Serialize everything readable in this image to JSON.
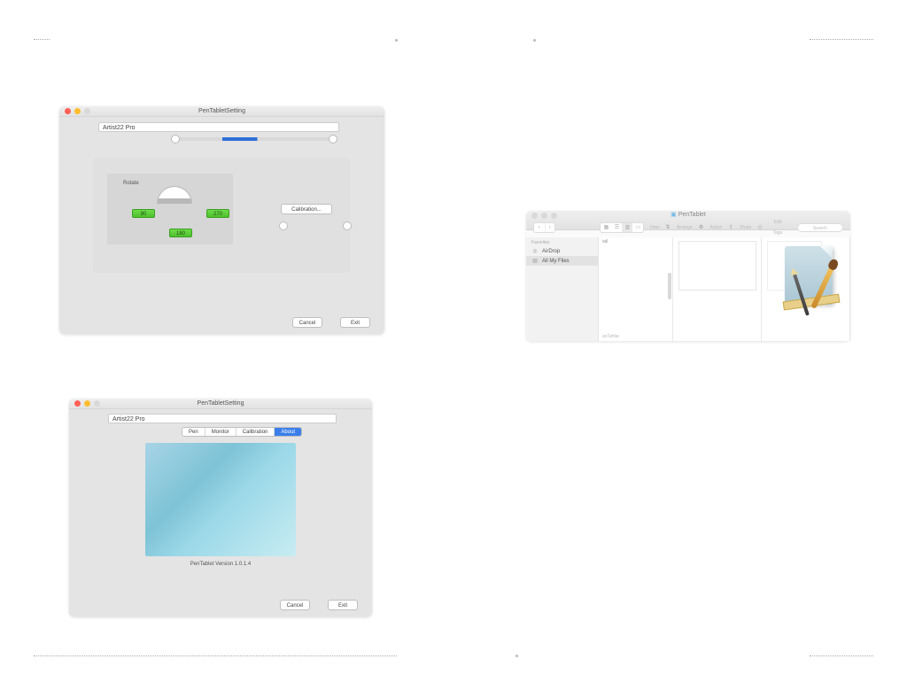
{
  "windowA": {
    "title": "PenTabletSetting",
    "device": "Artist22 Pro",
    "rotate_label": "Rotate",
    "rotate_values": {
      "v90": "90",
      "v180": "180",
      "v270": "270"
    },
    "calibration_btn": "Calibration...",
    "cancel": "Cancel",
    "exit": "Exit"
  },
  "windowB": {
    "title": "PenTabletSetting",
    "device": "Artist22 Pro",
    "tabs": {
      "pen": "Pen",
      "monitor": "Monitor",
      "calibration": "Calibration",
      "about": "About"
    },
    "version": "PenTablet Version  1.0.1.4",
    "cancel": "Cancel",
    "exit": "Exit"
  },
  "finder": {
    "title": "PenTablet",
    "toolbar": {
      "view_label": "View",
      "arrange": "Arrange",
      "action": "Action",
      "share": "Share",
      "edit_tags": "Edit Tags",
      "search_placeholder": "Search",
      "back_forward": "Back/Forward"
    },
    "sidebar": {
      "header": "Favorites",
      "items": [
        "AirDrop",
        "All My Files"
      ]
    },
    "col1": {
      "top_text": "tall",
      "bottom_text": "anTahlar"
    }
  }
}
